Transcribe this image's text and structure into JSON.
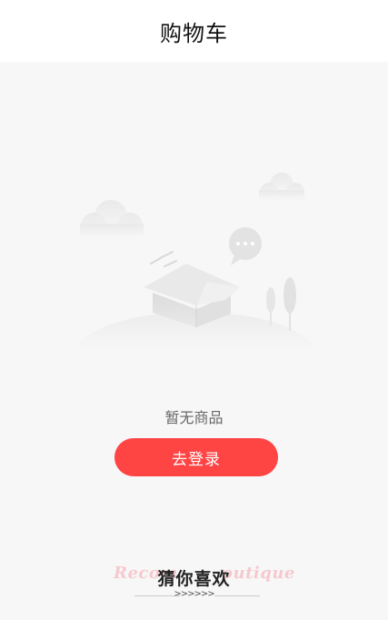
{
  "header": {
    "title": "购物车"
  },
  "empty_state": {
    "message": "暂无商品",
    "login_button_label": "去登录"
  },
  "recommend": {
    "title": "猜你喜欢",
    "bg_text_left": "Recom",
    "bg_text_right": "outique",
    "arrows": ">>>>>>"
  },
  "colors": {
    "accent": "#ff4444",
    "background": "#f7f7f7",
    "header_bg": "#ffffff"
  },
  "icons": [
    "empty-box-illustration",
    "cloud-icon",
    "chat-bubble-icon",
    "tree-icon"
  ]
}
